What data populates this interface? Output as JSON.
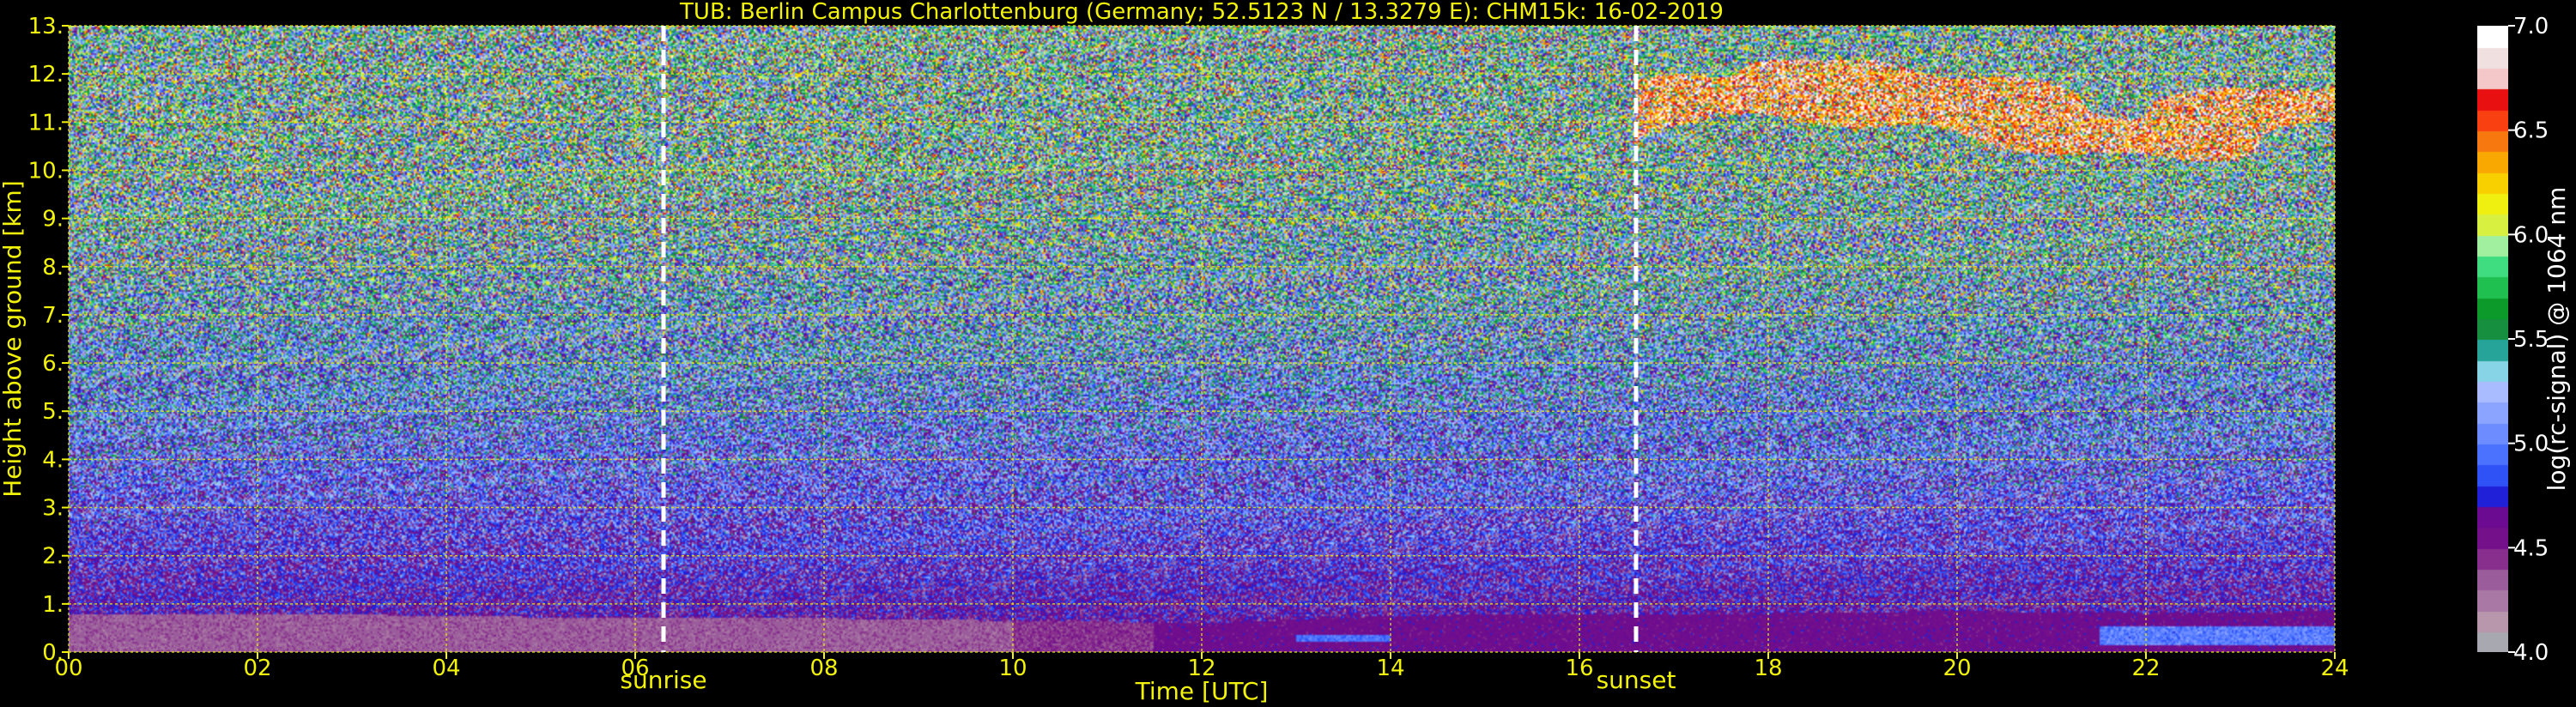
{
  "chart_data": {
    "type": "heatmap",
    "title": "TUB: Berlin Campus Charlottenburg (Germany; 52.5123 N / 13.3279 E):    CHM15k: 16-02-2019",
    "xlabel": "Time [UTC]",
    "ylabel": "Height above ground [km]",
    "xlim": [
      0,
      24
    ],
    "ylim": [
      0,
      13
    ],
    "x_ticks": [
      "00",
      "02",
      "04",
      "06",
      "08",
      "10",
      "12",
      "14",
      "16",
      "18",
      "20",
      "22",
      "24"
    ],
    "y_ticks": [
      "0.",
      "1.",
      "2.",
      "3.",
      "4.",
      "5.",
      "6.",
      "7.",
      "8.",
      "9.",
      "10.",
      "11.",
      "12.",
      "13."
    ],
    "grid": true,
    "colorbar": {
      "label": "log(rc-signal) @ 1064 nm",
      "range": [
        4.0,
        7.0
      ],
      "ticks": [
        "4.0",
        "4.5",
        "5.0",
        "5.5",
        "6.0",
        "6.5",
        "7.0"
      ],
      "colors": [
        "#a8a8b0",
        "#b896ac",
        "#a978a4",
        "#9a5c9a",
        "#882f8e",
        "#74108a",
        "#6a0b91",
        "#2020d8",
        "#2e52f6",
        "#4a72ff",
        "#6c8cff",
        "#8aa4ff",
        "#a8bcff",
        "#86d4e6",
        "#26a49a",
        "#168f3e",
        "#0c9a2a",
        "#20c050",
        "#40dc80",
        "#a0f0a0",
        "#d8f040",
        "#f0f010",
        "#f8d000",
        "#f8a800",
        "#f87810",
        "#f84010",
        "#e81010",
        "#f4c8c8",
        "#f0e0e0",
        "#ffffff"
      ]
    },
    "annotations": [
      {
        "text": "sunrise",
        "x": 6.3
      },
      {
        "text": "sunset",
        "x": 16.6
      }
    ],
    "layers": [
      {
        "name": "near-surface aerosol layer",
        "x_range": [
          0,
          24
        ],
        "top_km": [
          0.8,
          0.8,
          0.75,
          0.7,
          0.7,
          0.65,
          0.6,
          0.75,
          0.8,
          0.8,
          0.85,
          0.8,
          0.85
        ]
      },
      {
        "name": "high cloud",
        "x_range": [
          16.6,
          24
        ],
        "y_range": [
          10.0,
          12.3
        ]
      }
    ]
  }
}
